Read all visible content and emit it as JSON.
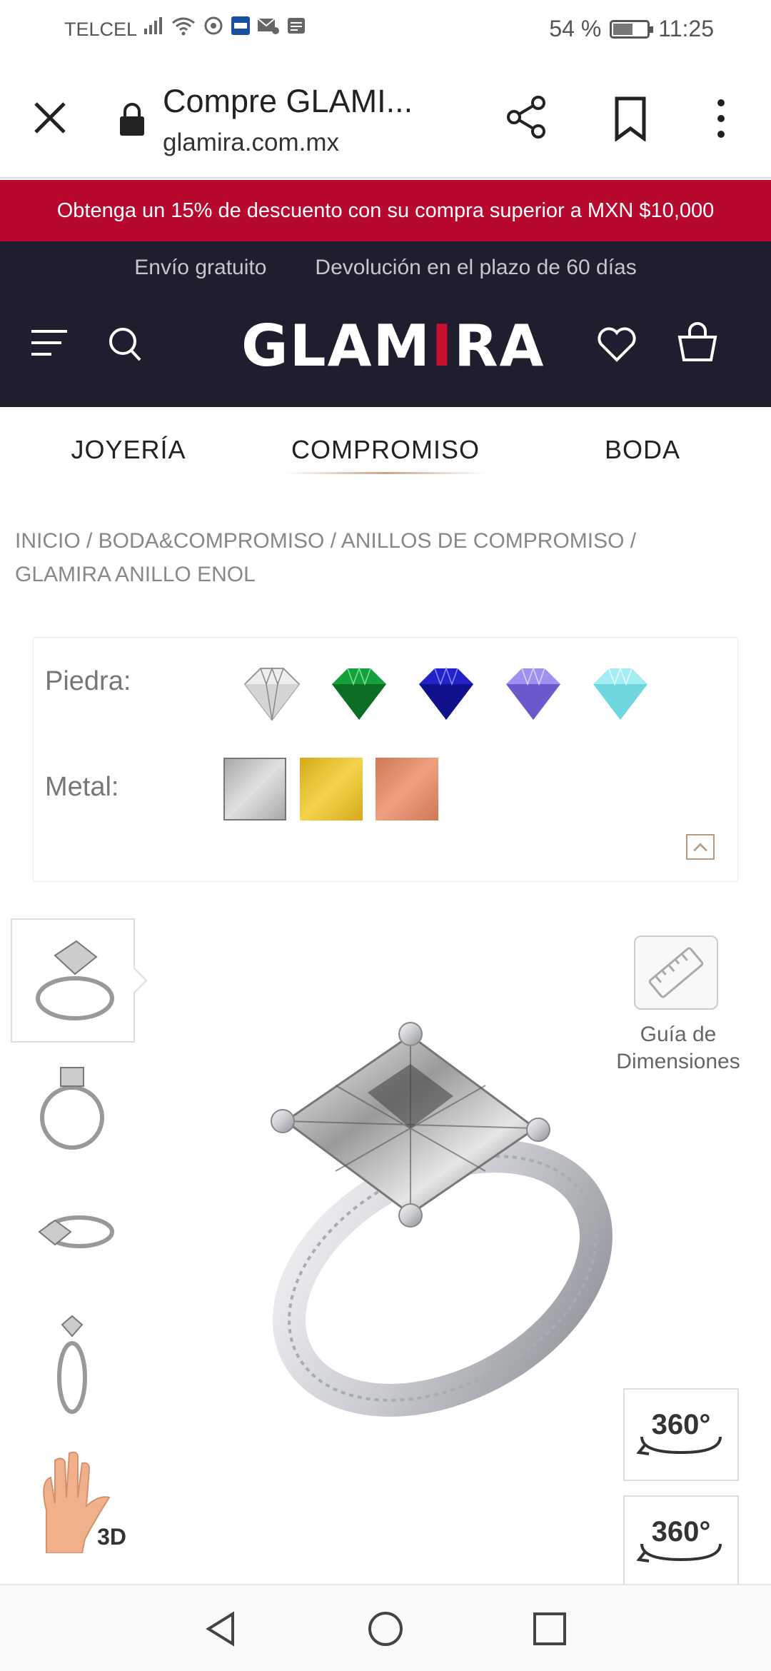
{
  "status_bar": {
    "carrier": "TELCEL",
    "battery": "54 %",
    "battery_level": 0.54,
    "time": "11:25"
  },
  "browser": {
    "title": "Compre GLAMI...",
    "url": "glamira.com.mx",
    "icons": [
      "close-icon",
      "lock-icon",
      "share-icon",
      "bookmark-icon",
      "more-icon"
    ]
  },
  "promo": {
    "text": "Obtenga un 15% de descuento con su compra superior a MXN $10,000",
    "color": "#b7082e"
  },
  "header": {
    "shipping": "Envío gratuito",
    "returns": "Devolución en el plazo de 60 días",
    "logo": "GLAMIRA",
    "background": "#1e1e2e"
  },
  "categories": [
    {
      "label": "JOYERÍA"
    },
    {
      "label": "COMPROMISO",
      "active": true
    },
    {
      "label": "BODA"
    }
  ],
  "breadcrumb": {
    "line1": "INICIO / BODA&COMPROMISO / ANILLOS DE COMPROMISO /",
    "line2": "GLAMIRA ANILLO ENOL"
  },
  "options": {
    "stone_label": "Piedra:",
    "metal_label": "Metal:",
    "stones": [
      {
        "name": "diamond",
        "color": "#e8e8e8"
      },
      {
        "name": "emerald",
        "color": "#0e8a2c"
      },
      {
        "name": "sapphire",
        "color": "#1a1ab0"
      },
      {
        "name": "amethyst",
        "color": "#8a7ae0"
      },
      {
        "name": "aquamarine",
        "color": "#8ee6ee"
      }
    ],
    "metals": [
      {
        "name": "white-gold",
        "color": "#c4c4c4",
        "selected": true
      },
      {
        "name": "yellow-gold",
        "color": "#e8c230"
      },
      {
        "name": "rose-gold",
        "color": "#df8f6c"
      }
    ]
  },
  "gallery": {
    "thumb_3d_badge": "3D",
    "size_guide_label_1": "Guía de",
    "size_guide_label_2": "Dimensiones",
    "btn_360": "360°"
  }
}
